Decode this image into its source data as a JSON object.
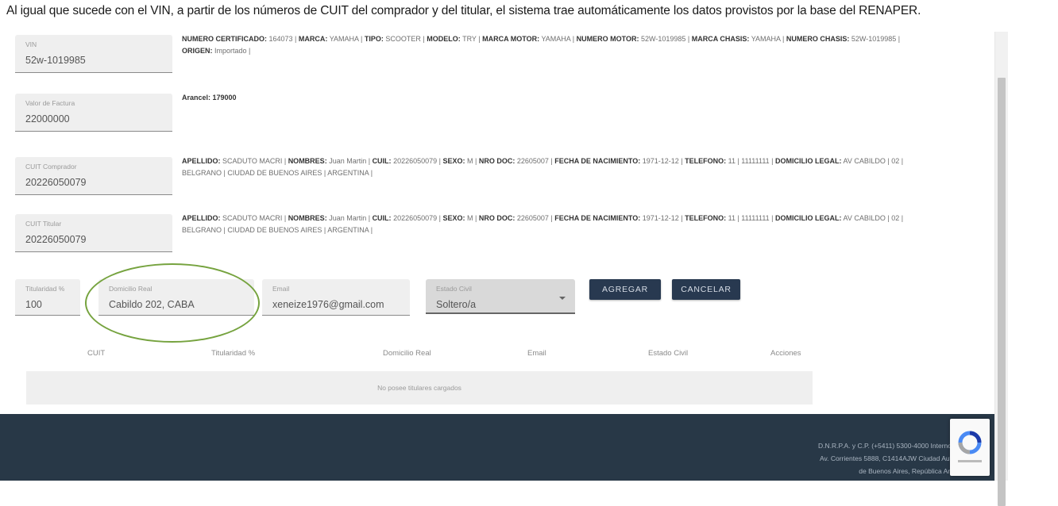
{
  "caption": "Al igual que sucede con el VIN, a partir de los números de CUIT del comprador y del titular, el sistema trae automáticamente los datos provistos por la base del RENAPER.",
  "vin": {
    "label": "VIN",
    "value": "52w-1019985",
    "info": [
      {
        "k": "NUMERO CERTIFICADO:",
        "v": " 164073 | "
      },
      {
        "k": "MARCA:",
        "v": " YAMAHA | "
      },
      {
        "k": "TIPO:",
        "v": " SCOOTER | "
      },
      {
        "k": "MODELO:",
        "v": " TRY | "
      },
      {
        "k": "MARCA MOTOR:",
        "v": " YAMAHA | "
      },
      {
        "k": "NUMERO MOTOR:",
        "v": " 52W-1019985 | "
      },
      {
        "k": "MARCA CHASIS:",
        "v": " YAMAHA | "
      },
      {
        "k": "NUMERO CHASIS:",
        "v": " 52W-1019985 | "
      },
      {
        "k": "ORIGEN:",
        "v": " Importado |"
      }
    ]
  },
  "factura": {
    "label": "Valor de Factura",
    "value": "22000000",
    "arancel": "Arancel: 179000"
  },
  "comprador": {
    "label": "CUIT Comprador",
    "value": "20226050079",
    "info": [
      {
        "k": "APELLIDO:",
        "v": " SCADUTO MACRI | "
      },
      {
        "k": "NOMBRES:",
        "v": " Juan Martin | "
      },
      {
        "k": "CUIL:",
        "v": " 20226050079 | "
      },
      {
        "k": "SEXO:",
        "v": " M | "
      },
      {
        "k": "NRO DOC:",
        "v": " 22605007 | "
      },
      {
        "k": "FECHA DE NACIMIENTO:",
        "v": " 1971-12-12 | "
      },
      {
        "k": "TELEFONO:",
        "v": " 11 | 11111111 | "
      },
      {
        "k": "DOMICILIO LEGAL:",
        "v": " AV CABILDO | 02 | BELGRANO | CIUDAD DE BUENOS AIRES | ARGENTINA |"
      }
    ]
  },
  "titular": {
    "label": "CUIT Titular",
    "value": "20226050079",
    "info": [
      {
        "k": "APELLIDO:",
        "v": " SCADUTO MACRI | "
      },
      {
        "k": "NOMBRES:",
        "v": " Juan Martin | "
      },
      {
        "k": "CUIL:",
        "v": " 20226050079 | "
      },
      {
        "k": "SEXO:",
        "v": " M | "
      },
      {
        "k": "NRO DOC:",
        "v": " 22605007 | "
      },
      {
        "k": "FECHA DE NACIMIENTO:",
        "v": " 1971-12-12 | "
      },
      {
        "k": "TELEFONO:",
        "v": " 11 | 11111111 | "
      },
      {
        "k": "DOMICILIO LEGAL:",
        "v": " AV CABILDO | 02 | BELGRANO | CIUDAD DE BUENOS AIRES | ARGENTINA |"
      }
    ]
  },
  "form": {
    "titularidad_label": "Titularidad %",
    "titularidad_value": "100",
    "domicilio_label": "Domicilio Real",
    "domicilio_value": "Cabildo 202, CABA",
    "email_label": "Email",
    "email_value": "xeneize1976@gmail.com",
    "estado_label": "Estado Civil",
    "estado_value": "Soltero/a",
    "agregar": "AGREGAR",
    "cancelar": "CANCELAR"
  },
  "table": {
    "headers": [
      "CUIT",
      "Titularidad %",
      "Domicilio Real",
      "Email",
      "Estado Civil",
      "Acciones"
    ],
    "empty": "No posee titulares cargados"
  },
  "footer": {
    "line1": "D.N.R.P.A. y C.P. (+5411) 5300-4000 Interno 77710",
    "line2": "Av. Corrientes 5888, C1414AJW Ciudad Autónoma",
    "line3": "de Buenos Aires, República Argentina"
  },
  "colors": {
    "footer_bg": "#283847",
    "button_bg": "#283950",
    "highlight": "#76a33f"
  }
}
